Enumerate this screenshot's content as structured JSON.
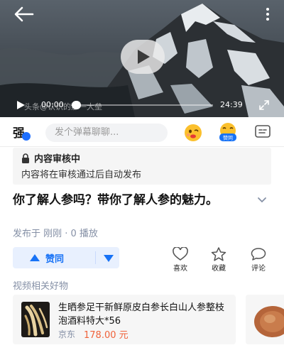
{
  "video": {
    "watermark_text": "头条@认识的那一大垒",
    "current_time": "00:00",
    "total_time": "24:39",
    "progress": 0,
    "icons": [
      "back-arrow-icon",
      "more-icon",
      "play-icon",
      "fullscreen-icon"
    ]
  },
  "comment_bar": {
    "avatar_char": "强",
    "placeholder": "发个弹幕聊聊...",
    "like_badge_label": "赞同",
    "icons": [
      "emoji-icon",
      "like-emoji-icon",
      "danmu-icon"
    ]
  },
  "review": {
    "title": "内容审核中",
    "description": "内容将在审核通过后自动发布"
  },
  "post": {
    "title": "你了解人参吗？带你了解人参的魅力。",
    "meta": "发布于 刚刚 · 0 播放"
  },
  "actions": {
    "vote_up_label": "赞同",
    "like_label": "喜欢",
    "favorite_label": "收藏",
    "comment_label": "评论"
  },
  "related": {
    "section_title": "视频相关好物",
    "items": [
      {
        "name": "生晒参足干新鲜原皮白参长白山人参整枝泡酒料特大*56",
        "shop": "京东",
        "price": "178.00 元"
      }
    ]
  },
  "colors": {
    "accent": "#1772f6",
    "price": "#f0623a",
    "muted": "#8590a6"
  }
}
